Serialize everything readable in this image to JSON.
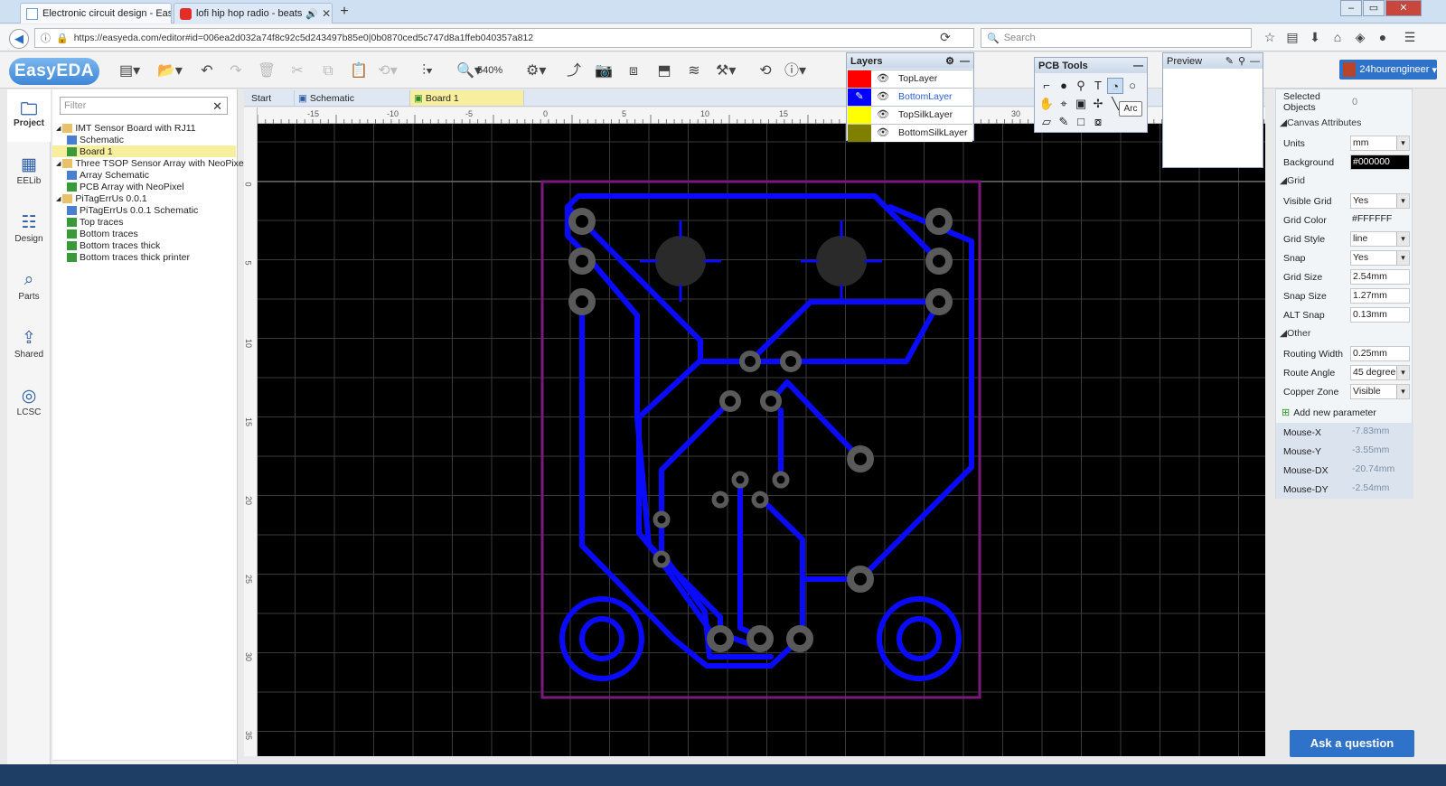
{
  "browser": {
    "tabs": [
      {
        "title": "Electronic circuit design - Eas",
        "active": true
      },
      {
        "title": "lofi hip hop radio - beats",
        "active": false
      }
    ],
    "url": "https://easyeda.com/editor#id=006ea2d032a74f8c92c5d243497b85e0|0b0870ced5c747d8a1ffeb040357a812",
    "search_placeholder": "Search",
    "window_controls": [
      "–",
      "▭",
      "✕"
    ]
  },
  "app": {
    "logo": "EasyEDA",
    "zoom": "540%",
    "user": "24hourengineer"
  },
  "left_nav": [
    {
      "label": "Project",
      "icon": "folder-icon"
    },
    {
      "label": "EELib",
      "icon": "chip-icon"
    },
    {
      "label": "Design",
      "icon": "list-icon"
    },
    {
      "label": "Parts",
      "icon": "magnify-icon"
    },
    {
      "label": "Shared",
      "icon": "share-icon"
    },
    {
      "label": "LCSC",
      "icon": "lcsc-icon"
    }
  ],
  "tree": {
    "filter_placeholder": "Filter",
    "items": [
      {
        "label": "IMT Sensor Board with RJ11",
        "kind": "folder"
      },
      {
        "label": "Schematic",
        "kind": "sch"
      },
      {
        "label": "Board 1",
        "kind": "pcb"
      },
      {
        "label": "Three TSOP Sensor Array with NeoPixe",
        "kind": "folder"
      },
      {
        "label": "Array Schematic",
        "kind": "sch"
      },
      {
        "label": "PCB Array with NeoPixel",
        "kind": "pcb"
      },
      {
        "label": "PiTagErrUs 0.0.1",
        "kind": "folder"
      },
      {
        "label": "PiTagErrUs 0.0.1 Schematic",
        "kind": "sch"
      },
      {
        "label": "Top traces",
        "kind": "pcb"
      },
      {
        "label": "Bottom traces",
        "kind": "pcb"
      },
      {
        "label": "Bottom traces thick",
        "kind": "pcb"
      },
      {
        "label": "Bottom traces thick printer",
        "kind": "pcb"
      }
    ]
  },
  "doc_tabs": [
    {
      "label": "Start"
    },
    {
      "label": "Schematic"
    },
    {
      "label": "Board 1"
    }
  ],
  "ruler": {
    "h": [
      "-15",
      "-10",
      "-5",
      "0",
      "5",
      "10",
      "15",
      "30"
    ],
    "v": [
      "0",
      "5",
      "10",
      "15",
      "20",
      "25",
      "30",
      "35"
    ]
  },
  "layers_panel": {
    "title": "Layers",
    "layers": [
      {
        "name": "TopLayer",
        "color": "#ff0000"
      },
      {
        "name": "BottomLayer",
        "color": "#0000ff"
      },
      {
        "name": "TopSilkLayer",
        "color": "#ffff00"
      },
      {
        "name": "BottomSilkLayer",
        "color": "#808000"
      }
    ]
  },
  "pcb_tools": {
    "title": "PCB Tools",
    "tooltip": "Arc"
  },
  "preview": {
    "title": "Preview"
  },
  "properties": {
    "selected_label": "Selected Objects",
    "selected_value": "0",
    "canvas_section": "Canvas Attributes",
    "units": {
      "label": "Units",
      "value": "mm"
    },
    "background": {
      "label": "Background",
      "value": "#000000"
    },
    "grid_section": "Grid",
    "visible_grid": {
      "label": "Visible Grid",
      "value": "Yes"
    },
    "grid_color": {
      "label": "Grid Color",
      "value": "#FFFFFF"
    },
    "grid_style": {
      "label": "Grid Style",
      "value": "line"
    },
    "snap": {
      "label": "Snap",
      "value": "Yes"
    },
    "grid_size": {
      "label": "Grid Size",
      "value": "2.54mm"
    },
    "snap_size": {
      "label": "Snap Size",
      "value": "1.27mm"
    },
    "alt_snap": {
      "label": "ALT Snap",
      "value": "0.13mm"
    },
    "other_section": "Other",
    "routing_width": {
      "label": "Routing Width",
      "value": "0.25mm"
    },
    "route_angle": {
      "label": "Route Angle",
      "value": "45 degree"
    },
    "copper_zone": {
      "label": "Copper Zone",
      "value": "Visible"
    },
    "add_param": "Add new parameter",
    "mouse_x": {
      "label": "Mouse-X",
      "value": "-7.83mm"
    },
    "mouse_y": {
      "label": "Mouse-Y",
      "value": "-3.55mm"
    },
    "mouse_dx": {
      "label": "Mouse-DX",
      "value": "-20.74mm"
    },
    "mouse_dy": {
      "label": "Mouse-DY",
      "value": "-2.54mm"
    }
  },
  "ask_button": "Ask a question",
  "colors": {
    "trace": "#0000ff",
    "board_outline": "#7a1a7a",
    "pad": "#5a5a5a",
    "accent": "#2f72c9"
  }
}
